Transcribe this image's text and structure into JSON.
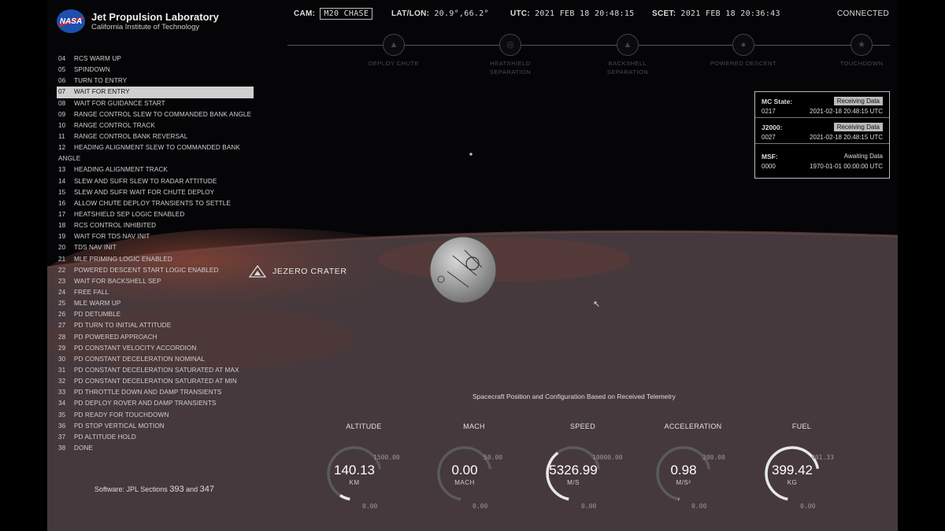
{
  "header": {
    "org_title": "Jet Propulsion Laboratory",
    "org_sub": "California Institute of Technology",
    "nasa": "NASA",
    "cam_label": "CAM:",
    "cam_value": "M20 CHASE",
    "latlon_label": "LAT/LON:",
    "latlon_value": "20.9°,66.2°",
    "utc_label": "UTC:",
    "utc_value": "2021 FEB 18 20:48:15",
    "scet_label": "SCET:",
    "scet_value": "2021 FEB 18 20:36:43",
    "status": "CONNECTED"
  },
  "timeline": {
    "milestones": [
      {
        "label": "DEPLOY CHUTE",
        "icon": "parachute-icon"
      },
      {
        "label": "HEATSHIELD SEPARATION",
        "icon": "heatshield-icon"
      },
      {
        "label": "BACKSHELL SEPARATION",
        "icon": "backshell-icon"
      },
      {
        "label": "POWERED DESCENT",
        "icon": "rocket-icon"
      },
      {
        "label": "TOUCHDOWN",
        "icon": "star-icon"
      }
    ]
  },
  "steps": [
    {
      "n": "04",
      "label": "RCS WARM UP"
    },
    {
      "n": "05",
      "label": "SPINDOWN"
    },
    {
      "n": "06",
      "label": "TURN TO ENTRY"
    },
    {
      "n": "07",
      "label": "WAIT FOR ENTRY",
      "active": true
    },
    {
      "n": "08",
      "label": "WAIT FOR GUIDANCE START"
    },
    {
      "n": "09",
      "label": "RANGE CONTROL SLEW TO COMMANDED BANK ANGLE"
    },
    {
      "n": "10",
      "label": "RANGE CONTROL TRACK"
    },
    {
      "n": "11",
      "label": "RANGE CONTROL BANK REVERSAL"
    },
    {
      "n": "12",
      "label": "HEADING ALIGNMENT SLEW TO COMMANDED BANK ANGLE",
      "wrap": true
    },
    {
      "n": "13",
      "label": "HEADING ALIGNMENT TRACK"
    },
    {
      "n": "14",
      "label": "SLEW AND SUFR SLEW TO RADAR ATTITUDE"
    },
    {
      "n": "15",
      "label": "SLEW AND SUFR WAIT FOR CHUTE DEPLOY"
    },
    {
      "n": "16",
      "label": "ALLOW CHUTE DEPLOY TRANSIENTS TO SETTLE"
    },
    {
      "n": "17",
      "label": "HEATSHIELD SEP LOGIC ENABLED"
    },
    {
      "n": "18",
      "label": "RCS CONTROL INHIBITED"
    },
    {
      "n": "19",
      "label": "WAIT FOR TDS NAV INIT"
    },
    {
      "n": "20",
      "label": "TDS NAV INIT"
    },
    {
      "n": "21",
      "label": "MLE PRIMING LOGIC ENABLED"
    },
    {
      "n": "22",
      "label": "POWERED DESCENT START LOGIC ENABLED"
    },
    {
      "n": "23",
      "label": "WAIT FOR BACKSHELL SEP"
    },
    {
      "n": "24",
      "label": "FREE FALL"
    },
    {
      "n": "25",
      "label": "MLE WARM UP"
    },
    {
      "n": "26",
      "label": "PD DETUMBLE"
    },
    {
      "n": "27",
      "label": "PD TURN TO INITIAL ATTITUDE"
    },
    {
      "n": "28",
      "label": "PD POWERED APPROACH"
    },
    {
      "n": "29",
      "label": "PD CONSTANT VELOCITY ACCORDION"
    },
    {
      "n": "30",
      "label": "PD CONSTANT DECELERATION NOMINAL"
    },
    {
      "n": "31",
      "label": "PD CONSTANT DECELERATION SATURATED AT MAX"
    },
    {
      "n": "32",
      "label": "PD CONSTANT DECELERATION SATURATED AT MIN"
    },
    {
      "n": "33",
      "label": "PD THROTTLE DOWN AND DAMP TRANSIENTS"
    },
    {
      "n": "34",
      "label": "PD DEPLOY ROVER AND DAMP TRANSIENTS"
    },
    {
      "n": "35",
      "label": "PD READY FOR TOUCHDOWN"
    },
    {
      "n": "36",
      "label": "PD STOP VERTICAL MOTION"
    },
    {
      "n": "37",
      "label": "PD ALTITUDE HOLD"
    },
    {
      "n": "38",
      "label": "DONE"
    }
  ],
  "software": {
    "text": "Software: JPL Sections",
    "a": "393",
    "and": "and",
    "b": "347"
  },
  "data_panel": [
    {
      "key": "MC State:",
      "status": "Receiving Data",
      "id": "0217",
      "time": "2021-02-18 20:48:15 UTC",
      "pill": true
    },
    {
      "key": "J2000:",
      "status": "Receiving Data",
      "id": "0027",
      "time": "2021-02-18 20:48:15 UTC",
      "pill": true
    },
    {
      "key": "MSF:",
      "status": "Awaiting Data",
      "id": "0000",
      "time": "1970-01-01 00:00:00 UTC",
      "pill": false
    }
  ],
  "landmark": "JEZERO CRATER",
  "caption": "Spacecraft Position and Configuration Based on Received Telemetry",
  "gauges": [
    {
      "label": "ALTITUDE",
      "value": "140.13",
      "unit": "KM",
      "max": "1500.00",
      "min": "0.00",
      "fraction": 0.093
    },
    {
      "label": "MACH",
      "value": "0.00",
      "unit": "MACH",
      "max": "50.00",
      "min": "0.00",
      "fraction": 0.0
    },
    {
      "label": "SPEED",
      "value": "5326.99",
      "unit": "M/S",
      "max": "10000.00",
      "min": "0.00",
      "fraction": 0.533
    },
    {
      "label": "ACCELERATION",
      "value": "0.98",
      "unit": "M/S²",
      "max": "200.00",
      "min": "0.00",
      "fraction": 0.005
    },
    {
      "label": "FUEL",
      "value": "399.42",
      "unit": "KG",
      "max": "401.33",
      "min": "0.00",
      "fraction": 0.995
    }
  ],
  "colors": {
    "planet": "#4a3a3e",
    "highlight": "#cfcfcf",
    "nasa_blue": "#1c4fb0"
  }
}
